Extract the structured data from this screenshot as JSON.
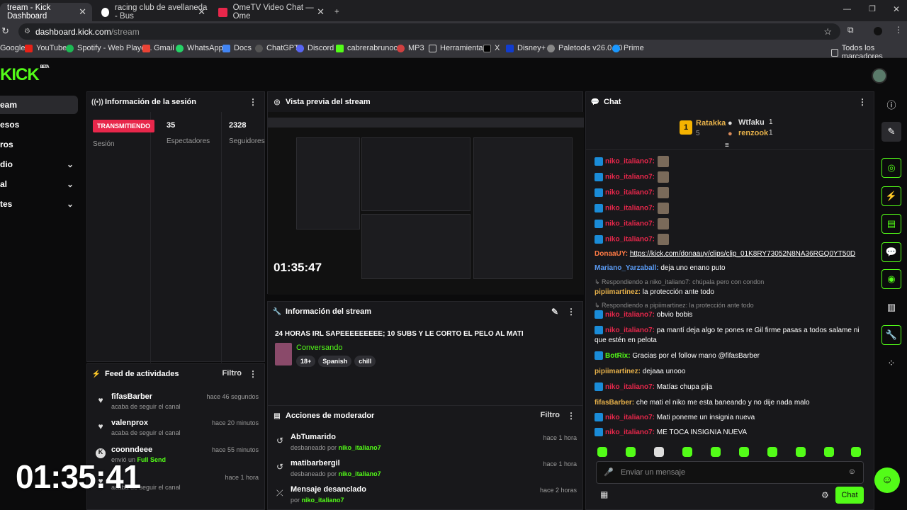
{
  "tabs": [
    {
      "title": "tream - Kick Dashboard",
      "active": true
    },
    {
      "title": "racing club de avellaneda - Bus",
      "active": false
    },
    {
      "title": "OmeTV Video Chat — Ome",
      "active": false
    }
  ],
  "address": {
    "host": "dashboard.kick.com",
    "path": "/stream"
  },
  "bookmarks": [
    "Google",
    "YouTube",
    "Spotify - Web Playe...",
    "Gmail",
    "WhatsApp",
    "Docs",
    "ChatGPT",
    "Discord",
    "cabrerabrunooo",
    "MP3",
    "Herramientas",
    "X",
    "Disney+",
    "Paletools v26.0.10",
    "Prime",
    "Todos los marcadores"
  ],
  "logo": {
    "text": "KICK",
    "sup": "BETA"
  },
  "sidebar": {
    "items": [
      {
        "label": "eam"
      },
      {
        "label": "esos"
      },
      {
        "label": "ros"
      },
      {
        "label": "dio"
      },
      {
        "label": "al"
      },
      {
        "label": "tes"
      }
    ]
  },
  "session": {
    "title": "Información de la sesión",
    "status": "TRANSMITIENDO",
    "status_label": "Sesión",
    "viewers": "35",
    "viewers_label": "Espectadores",
    "followers": "2328",
    "followers_label": "Seguidores"
  },
  "preview": {
    "title": "Vista previa del stream",
    "timer": "01:35:47"
  },
  "overlay_timer": "01:35:41",
  "stream_info": {
    "title": "Información del stream",
    "stream_title": "24 HORAS IRL SAPEEEEEEEEE; 10 SUBS Y LE CORTO EL PELO AL MATI",
    "category": "Conversando",
    "tags": [
      "18+",
      "Spanish",
      "chill"
    ]
  },
  "activity": {
    "title": "Feed de actividades",
    "filter": "Filtro",
    "items": [
      {
        "name": "fifasBarber",
        "desc": "acaba de seguir el canal",
        "time": "hace 46 segundos",
        "icon": "heart-icon"
      },
      {
        "name": "valenprox",
        "desc": "acaba de seguir el canal",
        "time": "hace 20 minutos",
        "icon": "heart-icon"
      },
      {
        "name": "coonndeee",
        "desc": "envió un",
        "desc2": "Full Send",
        "time": "hace 55 minutos",
        "icon": "kick-icon"
      },
      {
        "name": "",
        "desc": "acaba de seguir el canal",
        "time": "hace 1 hora",
        "icon": "heart-icon"
      }
    ]
  },
  "mod": {
    "title": "Acciones de moderador",
    "filter": "Filtro",
    "items": [
      {
        "name": "AbTumarido",
        "desc": "desbaneado por",
        "by": "niko_italiano7",
        "time": "hace 1 hora"
      },
      {
        "name": "matibarbergil",
        "desc": "desbaneado por",
        "by": "niko_italiano7",
        "time": "hace 1 hora"
      },
      {
        "name": "Mensaje desanclado",
        "desc": "por",
        "by": "niko_italiano7",
        "time": "hace 2 horas"
      }
    ]
  },
  "chat": {
    "title": "Chat",
    "top_gifters": [
      {
        "name": "Ratakka",
        "count": "5",
        "rank": "1"
      },
      {
        "name": "Wtfaku",
        "count": "1"
      },
      {
        "name": "renzook",
        "count": "1"
      }
    ],
    "messages": [
      {
        "user": "niko_italiano7:",
        "text": "",
        "cls": "u-red"
      },
      {
        "user": "niko_italiano7:",
        "text": "",
        "cls": "u-red"
      },
      {
        "user": "niko_italiano7:",
        "text": "",
        "cls": "u-red"
      },
      {
        "user": "niko_italiano7:",
        "text": "",
        "cls": "u-red"
      },
      {
        "user": "niko_italiano7:",
        "text": "",
        "cls": "u-red"
      },
      {
        "user": "niko_italiano7:",
        "text": "",
        "cls": "u-red"
      },
      {
        "user": "DonaaUY:",
        "text": "https://kick.com/donaauy/clips/clip_01K8RY73052N8NA36RGQ0YT50D",
        "cls": "u-orange"
      },
      {
        "user": "Mariano_Yarzaball:",
        "text": "deja uno enano puto",
        "cls": "u-blue"
      },
      {
        "reply": "Respondiendo a niko_italiano7: chúpala pero con condon"
      },
      {
        "user": "pipiimartinez:",
        "text": "la protección ante todo",
        "cls": "u-gold"
      },
      {
        "reply": "Respondiendo a pipiimartinez: la protección ante todo"
      },
      {
        "user": "niko_italiano7:",
        "text": "obvio bobis",
        "cls": "u-red"
      },
      {
        "user": "niko_italiano7:",
        "text": "pa mantí deja algo te pones re Gil firme pasas a todos salame ni que estén en pelota",
        "cls": "u-red"
      },
      {
        "user": "BotRix:",
        "text": "Gracias por el follow mano @fifasBarber",
        "cls": "u-green"
      },
      {
        "user": "pipiimartinez:",
        "text": "dejaaa unooo",
        "cls": "u-gold"
      },
      {
        "user": "niko_italiano7:",
        "text": "Matías chupa pija",
        "cls": "u-red"
      },
      {
        "user": "fifasBarber:",
        "text": "che mati el niko me esta baneando y no dije nada malo",
        "cls": "u-gold"
      },
      {
        "user": "niko_italiano7:",
        "text": "Mati poneme un insignia nueva",
        "cls": "u-red"
      },
      {
        "user": "niko_italiano7:",
        "text": "ME TOCA INSIGNIA NUEVA",
        "cls": "u-red"
      }
    ],
    "input_placeholder": "Enviar un mensaje",
    "send_label": "Chat"
  },
  "colors": {
    "kick_green": "#53fc18",
    "live_red": "#e8274b",
    "panel": "#18181b"
  }
}
